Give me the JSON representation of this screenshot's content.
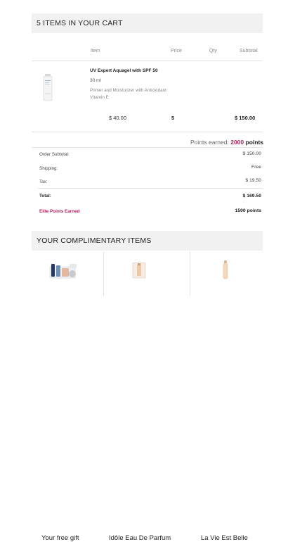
{
  "cart": {
    "title": "5 ITEMS IN YOUR CART",
    "columns": {
      "item": "Item",
      "price": "Price",
      "qty": "Qty",
      "subtotal": "Subtotal"
    },
    "product": {
      "image_icon": "moisturizer-tube-icon",
      "name": "UV Expert Aquagel with SPF 50",
      "size": "30 ml",
      "description": "Primer and Moisturizer with Antioxidant Vitamin E",
      "price": "$ 40.00",
      "qty": "5",
      "total": "$ 150.00"
    },
    "points": {
      "label": "Points earned: ",
      "value": "2000",
      "unit": " points"
    },
    "summary": {
      "order_subtotal_label": "Order Subtotal:",
      "order_subtotal": "$ 150.00",
      "shipping_label": "Shipping:",
      "shipping": "Free",
      "tax_label": "Tax:",
      "tax": "$ 19.50",
      "total_label": "Total:",
      "total": "$ 169.50",
      "elite_label": "Elite Points Earned",
      "elite_points": "1500 points"
    }
  },
  "complimentary": {
    "title": "YOUR COMPLIMENTARY ITEMS",
    "items": [
      {
        "label": "Your free gift",
        "icon": "gift-set-icon"
      },
      {
        "label": "Idôle Eau De Parfum",
        "icon": "perfume-sample-icon"
      },
      {
        "label": "La Vie Est Belle",
        "icon": "perfume-vial-icon"
      }
    ]
  },
  "colors": {
    "accent": "#b0205b",
    "header_bg": "#f1f1f1",
    "divider": "#e3e3e3"
  }
}
